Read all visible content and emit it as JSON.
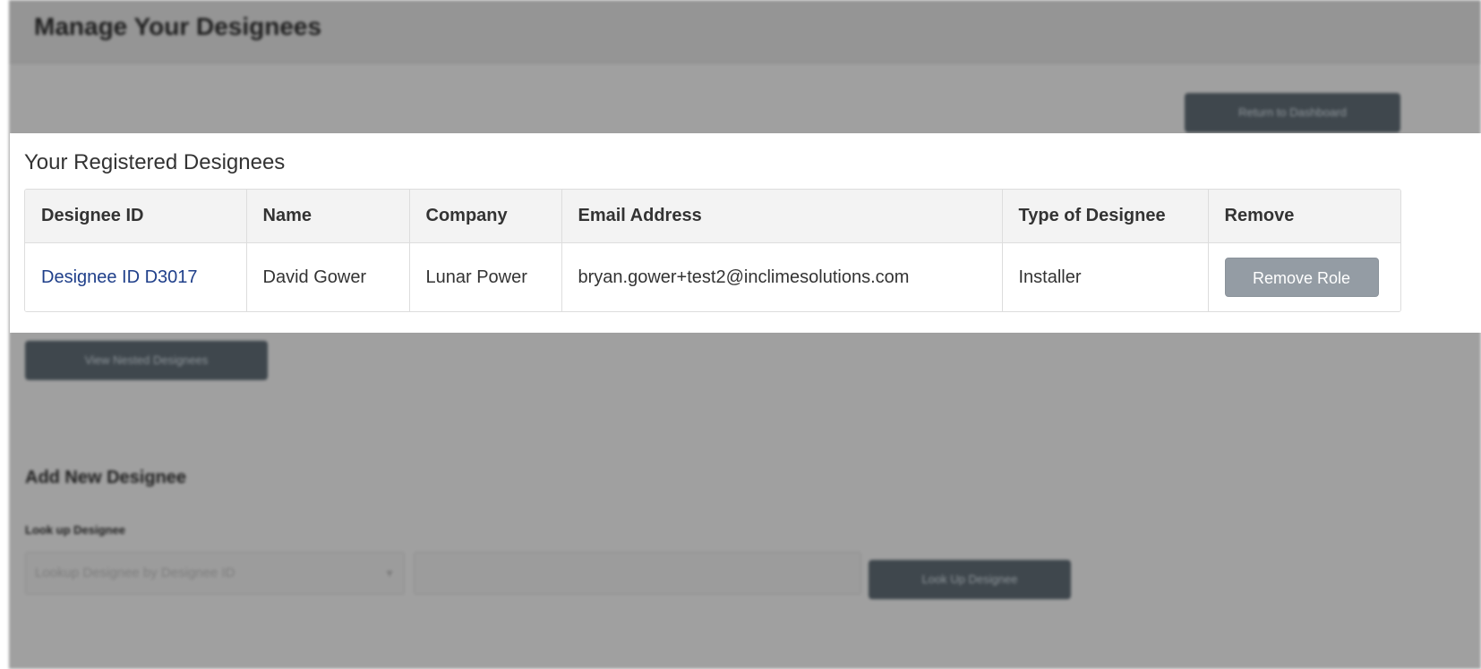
{
  "header": {
    "title": "Manage Your Designees",
    "return_button": "Return to Dashboard"
  },
  "designees": {
    "heading": "Your Registered Designees",
    "columns": [
      "Designee ID",
      "Name",
      "Company",
      "Email Address",
      "Type of Designee",
      "Remove"
    ],
    "rows": [
      {
        "designee_id": "Designee ID D3017",
        "name": "David Gower",
        "company": "Lunar Power",
        "email": "bryan.gower+test2@inclimesolutions.com",
        "type": "Installer",
        "remove_label": "Remove Role"
      }
    ],
    "nested_button": "View Nested Designees"
  },
  "add_designee": {
    "heading": "Add New Designee",
    "lookup_label": "Look up Designee",
    "select_value": "Lookup Designee by Designee ID",
    "input_value": "",
    "lookup_button": "Look Up Designee"
  },
  "colors": {
    "overlay": "#a0a0a0",
    "panel": "#ffffff",
    "link": "#1f3f8a",
    "button_dark": "#3f474d",
    "button_remove": "#949ca4"
  }
}
